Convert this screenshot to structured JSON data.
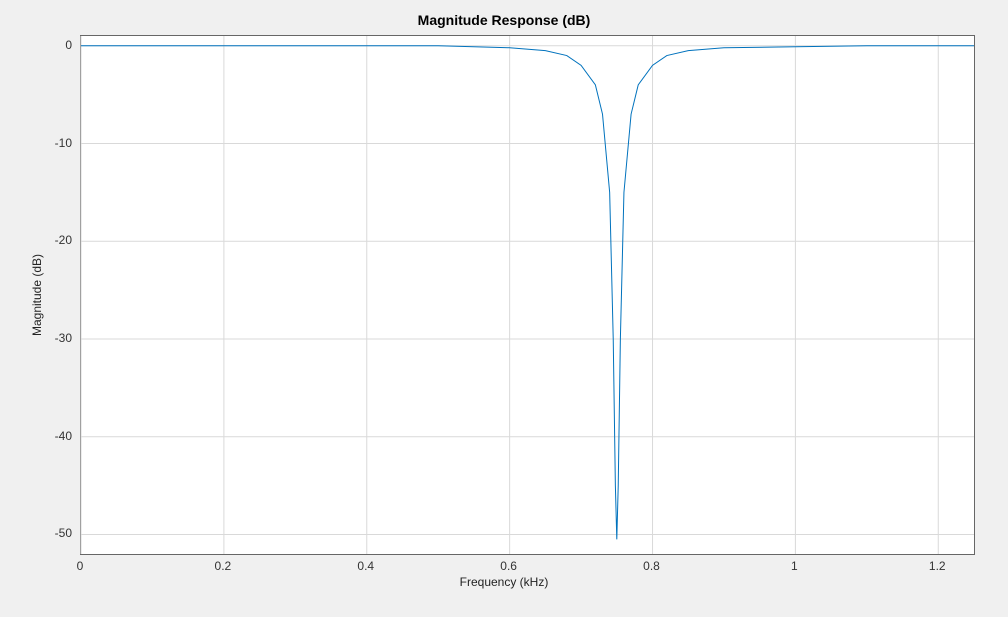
{
  "chart_data": {
    "type": "line",
    "title": "Magnitude Response (dB)",
    "xlabel": "Frequency (kHz)",
    "ylabel": "Magnitude (dB)",
    "xlim": [
      0,
      1.25
    ],
    "ylim": [
      -52,
      1
    ],
    "xticks": [
      0,
      0.2,
      0.4,
      0.6,
      0.8,
      1.0,
      1.2
    ],
    "yticks": [
      0,
      -10,
      -20,
      -30,
      -40,
      -50
    ],
    "series": [
      {
        "name": "response",
        "color": "#0072bd",
        "x": [
          0.0,
          0.1,
          0.2,
          0.3,
          0.4,
          0.5,
          0.55,
          0.6,
          0.65,
          0.68,
          0.7,
          0.72,
          0.73,
          0.74,
          0.745,
          0.748,
          0.75,
          0.752,
          0.755,
          0.76,
          0.77,
          0.78,
          0.8,
          0.82,
          0.85,
          0.9,
          1.0,
          1.1,
          1.2,
          1.25
        ],
        "y": [
          0.0,
          0.0,
          0.0,
          0.0,
          0.0,
          0.0,
          -0.1,
          -0.2,
          -0.5,
          -1.0,
          -2.0,
          -4.0,
          -7.0,
          -15.0,
          -30.0,
          -45.0,
          -50.5,
          -45.0,
          -30.0,
          -15.0,
          -7.0,
          -4.0,
          -2.0,
          -1.0,
          -0.5,
          -0.2,
          -0.1,
          0.0,
          0.0,
          0.0
        ]
      }
    ]
  }
}
